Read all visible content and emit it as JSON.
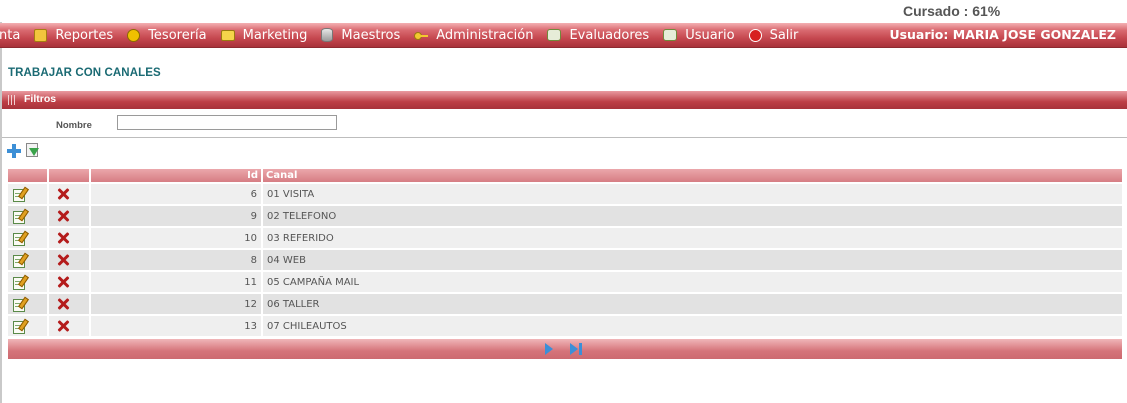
{
  "header": {
    "progress_text": "Cursado : 61%",
    "progress_percent": 61
  },
  "menu": {
    "items": [
      {
        "label": "nta",
        "icon": ""
      },
      {
        "label": "Reportes",
        "icon": "folder-icon"
      },
      {
        "label": "Tesorería",
        "icon": "coin-icon"
      },
      {
        "label": "Marketing",
        "icon": "marketing-icon"
      },
      {
        "label": "Maestros",
        "icon": "database-icon"
      },
      {
        "label": "Administración",
        "icon": "key-icon"
      },
      {
        "label": "Evaluadores",
        "icon": "evaluators-icon"
      },
      {
        "label": "Usuario",
        "icon": "user-icon"
      },
      {
        "label": "Salir",
        "icon": "exit-icon"
      }
    ],
    "user_label": "Usuario:  MARIA JOSE GONZALEZ"
  },
  "page": {
    "title": "TRABAJAR CON CANALES"
  },
  "filters": {
    "section_label": "Filtros",
    "nombre_label": "Nombre",
    "nombre_value": ""
  },
  "toolbar": {
    "add_icon": "add-icon",
    "export_icon": "export-icon"
  },
  "table": {
    "headers": [
      "",
      "",
      "Id",
      "Canal"
    ],
    "rows": [
      {
        "id": "6",
        "canal": "01 VISITA"
      },
      {
        "id": "9",
        "canal": "02 TELEFONO"
      },
      {
        "id": "10",
        "canal": "03 REFERIDO"
      },
      {
        "id": "8",
        "canal": "04 WEB"
      },
      {
        "id": "11",
        "canal": "05 CAMPAÑA MAIL"
      },
      {
        "id": "12",
        "canal": "06 TALLER"
      },
      {
        "id": "13",
        "canal": "07 CHILEAUTOS"
      }
    ]
  },
  "colors": {
    "menu_bar": "#c4464e",
    "title_text": "#1a6a73",
    "header_row": "#d67d83",
    "pager_bar": "#d5747a",
    "pager_icons": "#3b8fd8"
  }
}
